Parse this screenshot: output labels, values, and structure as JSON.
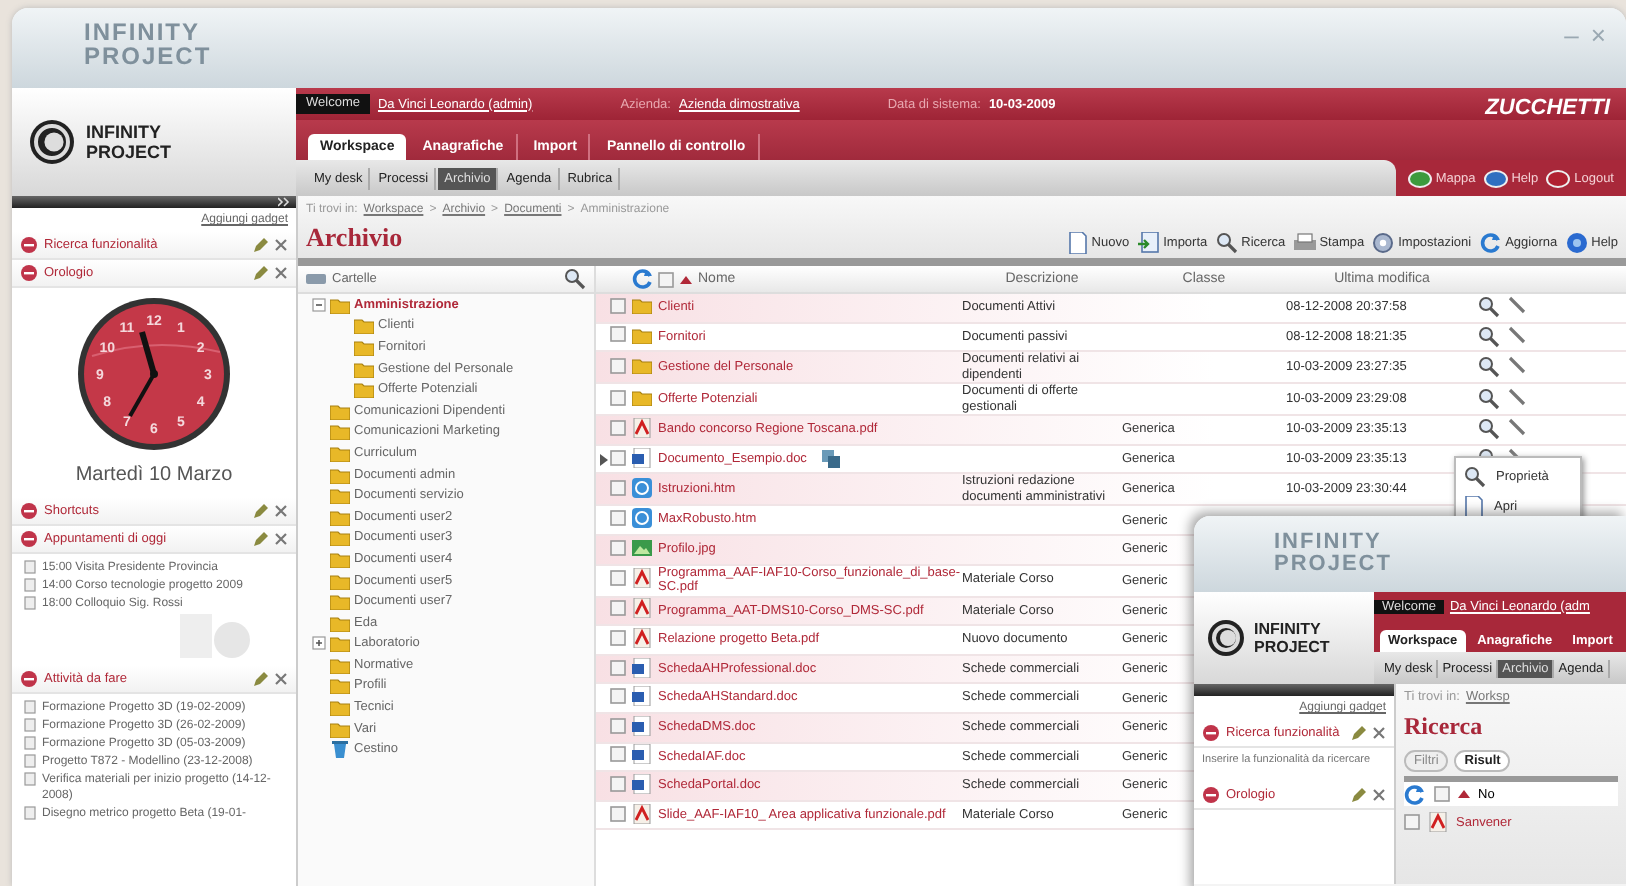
{
  "window": {
    "title": "INFINITY PROJECT",
    "controls": [
      "–",
      "×"
    ]
  },
  "header": {
    "logo": "INFINITY PROJECT",
    "welcome_label": "Welcome",
    "user": "Da Vinci Leonardo (admin)",
    "company_label": "Azienda:",
    "company": "Azienda dimostrativa",
    "date_label": "Data di sistema:",
    "date": "10-03-2009",
    "brand": "ZUCCHETTI",
    "main_tabs": [
      {
        "label": "Workspace",
        "selected": true
      },
      {
        "label": "Anagrafiche",
        "selected": false
      },
      {
        "label": "Import",
        "selected": false
      },
      {
        "label": "Pannello di controllo",
        "selected": false
      }
    ],
    "sub_tabs": [
      {
        "label": "My desk",
        "selected": false
      },
      {
        "label": "Processi",
        "selected": false
      },
      {
        "label": "Archivio",
        "selected": true
      },
      {
        "label": "Agenda",
        "selected": false
      },
      {
        "label": "Rubrica",
        "selected": false
      }
    ],
    "actions": [
      {
        "label": "Mappa",
        "color": "#3c9a3c"
      },
      {
        "label": "Help",
        "color": "#2f6fc0"
      },
      {
        "label": "Logout",
        "color": "#b02030"
      }
    ]
  },
  "sidebar": {
    "add_gadget": "Aggiungi gadget",
    "gadgets": [
      {
        "kind": "collapsed",
        "title": "Ricerca funzionalità"
      },
      {
        "kind": "clock",
        "title": "Orologio",
        "dial_numbers": [
          "12",
          "1",
          "2",
          "3",
          "4",
          "5",
          "6",
          "7",
          "8",
          "9",
          "10",
          "11"
        ],
        "caption": "Martedì 10 Marzo"
      },
      {
        "kind": "collapsed",
        "title": "Shortcuts"
      },
      {
        "kind": "list",
        "title": "Appuntamenti di oggi",
        "items": [
          "15:00 Visita Presidente Provincia",
          "14:00 Corso tecnologie progetto 2009",
          "18:00 Colloquio Sig. Rossi"
        ]
      },
      {
        "kind": "list",
        "title": "Attività da fare",
        "items": [
          "Formazione Progetto 3D (19-02-2009)",
          "Formazione Progetto 3D (26-02-2009)",
          "Formazione Progetto 3D (05-03-2009)",
          "Progetto T872 - Modellino (23-12-2008)",
          "Verifica materiali per inizio progetto (14-12-2008)",
          "Disegno metrico progetto Beta (19-01-"
        ]
      }
    ]
  },
  "breadcrumb": {
    "label": "Ti trovi in:",
    "separator": ">",
    "items": [
      "Workspace",
      "Archivio",
      "Documenti",
      "Amministrazione"
    ]
  },
  "page_title": "Archivio",
  "toolbar": [
    "Nuovo",
    "Importa",
    "Ricerca",
    "Stampa",
    "Impostazioni",
    "Aggiorna",
    "Help"
  ],
  "folders": {
    "title": "Cartelle",
    "tree": [
      {
        "label": "Amministrazione",
        "kind": "folder",
        "selected": true,
        "expanded": true,
        "children": [
          {
            "label": "Clienti",
            "kind": "folder",
            "selected": false
          },
          {
            "label": "Fornitori",
            "kind": "folder",
            "selected": false
          },
          {
            "label": "Gestione del Personale",
            "kind": "folder",
            "selected": false
          },
          {
            "label": "Offerte Potenziali",
            "kind": "folder",
            "selected": false
          }
        ]
      },
      {
        "label": "Comunicazioni Dipendenti",
        "kind": "folder",
        "selected": false
      },
      {
        "label": "Comunicazioni Marketing",
        "kind": "folder",
        "selected": false
      },
      {
        "label": "Curriculum",
        "kind": "folder",
        "selected": false
      },
      {
        "label": "Documenti admin",
        "kind": "folder",
        "selected": false
      },
      {
        "label": "Documenti servizio",
        "kind": "folder",
        "selected": false
      },
      {
        "label": "Documenti user2",
        "kind": "folder",
        "selected": false
      },
      {
        "label": "Documenti user3",
        "kind": "folder",
        "selected": false
      },
      {
        "label": "Documenti user4",
        "kind": "folder",
        "selected": false
      },
      {
        "label": "Documenti user5",
        "kind": "folder",
        "selected": false
      },
      {
        "label": "Documenti user7",
        "kind": "folder",
        "selected": false
      },
      {
        "label": "Eda",
        "kind": "folder",
        "selected": false
      },
      {
        "label": "Laboratorio",
        "kind": "folder",
        "selected": false,
        "expanded": false
      },
      {
        "label": "Normative",
        "kind": "folder",
        "selected": false
      },
      {
        "label": "Profili",
        "kind": "folder",
        "selected": false
      },
      {
        "label": "Tecnici",
        "kind": "folder",
        "selected": false
      },
      {
        "label": "Vari",
        "kind": "folder",
        "selected": false
      },
      {
        "label": "Cestino",
        "kind": "trash",
        "selected": false
      }
    ]
  },
  "table": {
    "all_checked": false,
    "columns": [
      "Nome",
      "Descrizione",
      "Classe",
      "Ultima modifica"
    ],
    "rows": [
      {
        "name": "Clienti",
        "kind": "folder",
        "description": "Documenti Attivi",
        "modified": "08-12-2008 20:37:58",
        "current": false,
        "checked": false
      },
      {
        "name": "Fornitori",
        "kind": "folder",
        "description": "Documenti passivi",
        "modified": "08-12-2008 18:21:35",
        "current": false,
        "checked": false
      },
      {
        "name": "Gestione del Personale",
        "kind": "folder",
        "description": "Documenti relativi ai dipendenti",
        "modified": "10-03-2009 23:27:35",
        "current": false,
        "checked": false
      },
      {
        "name": "Offerte Potenziali",
        "kind": "folder",
        "description": "Documenti di offerte gestionali",
        "modified": "10-03-2009 23:29:08",
        "current": false,
        "checked": false
      },
      {
        "name": "Bando concorso Regione Toscana.pdf",
        "kind": "pdf",
        "class": "Generica",
        "modified": "10-03-2009 23:35:13",
        "current": false,
        "checked": false
      },
      {
        "name": "Documento_Esempio.doc",
        "kind": "doc",
        "class": "Generica",
        "modified": "10-03-2009 23:35:13",
        "current": true,
        "checked": false
      },
      {
        "name": "Istruzioni.htm",
        "kind": "htm",
        "description": "Istruzioni redazione documenti amministrativi",
        "class": "Generica",
        "modified": "10-03-2009 23:30:44",
        "current": false,
        "checked": false
      },
      {
        "name": "MaxRobusto.htm",
        "kind": "htm",
        "class": "Generic",
        "current": false,
        "checked": false
      },
      {
        "name": "Profilo.jpg",
        "kind": "jpg",
        "class": "Generic",
        "current": false,
        "checked": false
      },
      {
        "name": "Programma_AAF-IAF10-Corso_funzionale_di_base-SC.pdf",
        "kind": "pdf",
        "description": "Materiale Corso",
        "class": "Generic",
        "current": false,
        "checked": false
      },
      {
        "name": "Programma_AAT-DMS10-Corso_DMS-SC.pdf",
        "kind": "pdf",
        "description": "Materiale Corso",
        "class": "Generic",
        "current": false,
        "checked": false
      },
      {
        "name": "Relazione progetto Beta.pdf",
        "kind": "pdf",
        "description": "Nuovo documento",
        "class": "Generic",
        "current": false,
        "checked": false
      },
      {
        "name": "SchedaAHProfessional.doc",
        "kind": "doc",
        "description": "Schede commerciali",
        "class": "Generic",
        "current": false,
        "checked": false
      },
      {
        "name": "SchedaAHStandard.doc",
        "kind": "doc",
        "description": "Schede commerciali",
        "class": "Generic",
        "current": false,
        "checked": false
      },
      {
        "name": "SchedaDMS.doc",
        "kind": "doc",
        "description": "Schede commerciali",
        "class": "Generic",
        "current": false,
        "checked": false
      },
      {
        "name": "SchedaIAF.doc",
        "kind": "doc",
        "description": "Schede commerciali",
        "class": "Generic",
        "current": false,
        "checked": false
      },
      {
        "name": "SchedaPortal.doc",
        "kind": "doc",
        "description": "Schede commerciali",
        "class": "Generic",
        "current": false,
        "checked": false
      },
      {
        "name": "Slide_AAF-IAF10_ Area applicativa funzionale.pdf",
        "kind": "pdf",
        "description": "Materiale Corso",
        "class": "Generic",
        "current": false,
        "checked": false
      }
    ]
  },
  "context_menu": [
    "Proprietà",
    "Apri"
  ],
  "overlay_window": {
    "title": "INFINITY PROJECT",
    "logo": "INFINITY PROJECT",
    "welcome_label": "Welcome",
    "user": "Da Vinci Leonardo (adm",
    "main_tabs": [
      {
        "label": "Workspace",
        "selected": true
      },
      {
        "label": "Anagrafiche",
        "selected": false
      },
      {
        "label": "Import",
        "selected": false
      }
    ],
    "sub_tabs": [
      {
        "label": "My desk",
        "selected": false
      },
      {
        "label": "Processi",
        "selected": false
      },
      {
        "label": "Archivio",
        "selected": true
      },
      {
        "label": "Agenda",
        "selected": false
      }
    ],
    "add_gadget": "Aggiungi gadget",
    "search_gadget": "Ricerca funzionalità",
    "search_placeholder": "Inserire la funzionalità da ricercare",
    "clock_gadget": "Orologio",
    "breadcrumb_label": "Ti trovi in:",
    "breadcrumb_item": "Worksp",
    "page_title": "Ricerca",
    "tabs": [
      {
        "label": "Filtri",
        "selected": false
      },
      {
        "label": "Risult",
        "selected": true
      }
    ],
    "all_checked": false,
    "column": "No",
    "row_name": "Sanvener",
    "row_checked": false
  }
}
